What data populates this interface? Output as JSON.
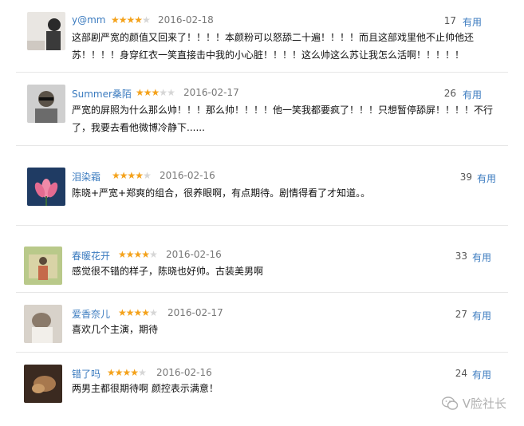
{
  "useful_label": "有用",
  "reviews": [
    {
      "user": "y@mm",
      "rating": 4,
      "date": "2016-02-18",
      "votes": "17",
      "lines": [
        "这部剧严宽的颜值又回来了！！！！本颜粉可以怒舔二十遍！！！！而且这部戏里他不止帅他还",
        "苏！！！！身穿红衣一笑直接击中我的小心脏！！！！这么帅这么苏让我怎么活啊！！！！！"
      ],
      "avatar_icon": "avatar-photo-icon"
    },
    {
      "user": "Summer桑陌",
      "rating": 3,
      "date": "2016-02-17",
      "votes": "26",
      "lines": [
        "严宽的屏照为什么那么帅！！！那么帅！！！！他一笑我都要疯了！！！只想暂停舔屏！！！！不行",
        "了，我要去看他微博冷静下......"
      ],
      "avatar_icon": "avatar-photo-icon"
    },
    {
      "user": "泪染霜",
      "rating": 4,
      "date": "2016-02-16",
      "votes": "39",
      "lines": [
        "陈晓+严宽+郑爽的组合，很养眼啊，有点期待。剧情得看了才知道。。"
      ],
      "avatar_icon": "avatar-lotus-icon"
    },
    {
      "user": "春暖花开",
      "rating": 4,
      "date": "2016-02-16",
      "votes": "33",
      "lines": [
        "感觉很不错的样子，陈晓也好帅。古装美男啊"
      ],
      "avatar_icon": "avatar-photo-icon"
    },
    {
      "user": "爱香奈儿",
      "rating": 4,
      "date": "2016-02-17",
      "votes": "27",
      "lines": [
        "喜欢几个主演，期待"
      ],
      "avatar_icon": "avatar-photo-icon"
    },
    {
      "user": "错了吗",
      "rating": 4,
      "date": "2016-02-16",
      "votes": "24",
      "lines": [
        "两男主都很期待啊 颜控表示满意！"
      ],
      "avatar_icon": "avatar-photo-icon"
    }
  ],
  "watermark": {
    "text": "V脸社长",
    "icon": "wechat-icon"
  },
  "colors": {
    "link": "#3b7bbf",
    "star_on": "#f4a21b",
    "star_off": "#d6d6d6"
  }
}
